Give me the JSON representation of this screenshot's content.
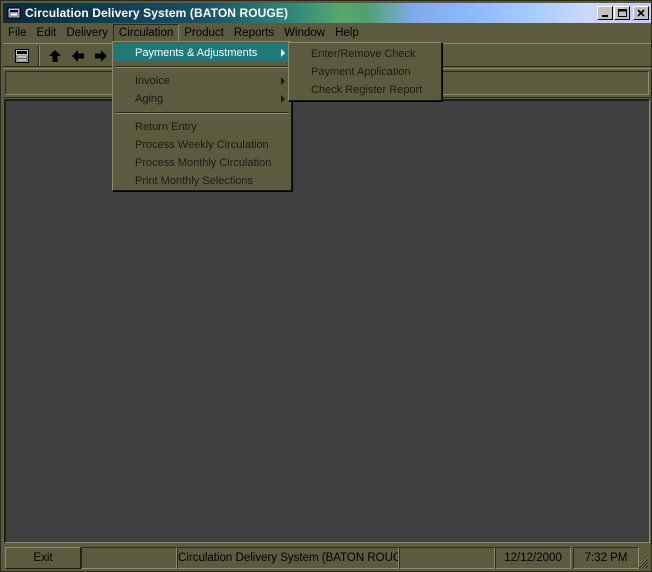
{
  "window": {
    "title": "Circulation Delivery System (BATON ROUGE)"
  },
  "menubar": {
    "items": [
      {
        "label": "File"
      },
      {
        "label": "Edit"
      },
      {
        "label": "Delivery"
      },
      {
        "label": "Circulation"
      },
      {
        "label": "Product"
      },
      {
        "label": "Reports"
      },
      {
        "label": "Window"
      },
      {
        "label": "Help"
      }
    ],
    "open_item": "Circulation"
  },
  "toolbar": {
    "icons": [
      "form-icon",
      "arrow-up-icon",
      "arrow-left-icon",
      "arrow-right-icon"
    ]
  },
  "circulation_menu": {
    "groups": [
      [
        {
          "label": "Payments & Adjustments",
          "submenu": true,
          "active": true
        }
      ],
      [
        {
          "label": "Invoice",
          "submenu": true
        },
        {
          "label": "Aging",
          "submenu": true
        }
      ],
      [
        {
          "label": "Return Entry"
        },
        {
          "label": "Process Weekly Circulation"
        },
        {
          "label": "Process Monthly Circulation"
        },
        {
          "label": "Print Monthly Selections"
        }
      ]
    ]
  },
  "payments_submenu": {
    "items": [
      {
        "label": "Enter/Remove Check"
      },
      {
        "label": "Payment Application"
      },
      {
        "label": "Check Register Report"
      }
    ]
  },
  "statusbar": {
    "exit_label": "Exit",
    "panel_blank": "",
    "app_name": "Circulation Delivery System (BATON ROUGE)",
    "panel_blank2": "",
    "date": "12/12/2000",
    "time": "7:32 PM"
  },
  "colors": {
    "face": "#5b5b3f",
    "client": "#404040",
    "highlight": "#1e7a78"
  }
}
